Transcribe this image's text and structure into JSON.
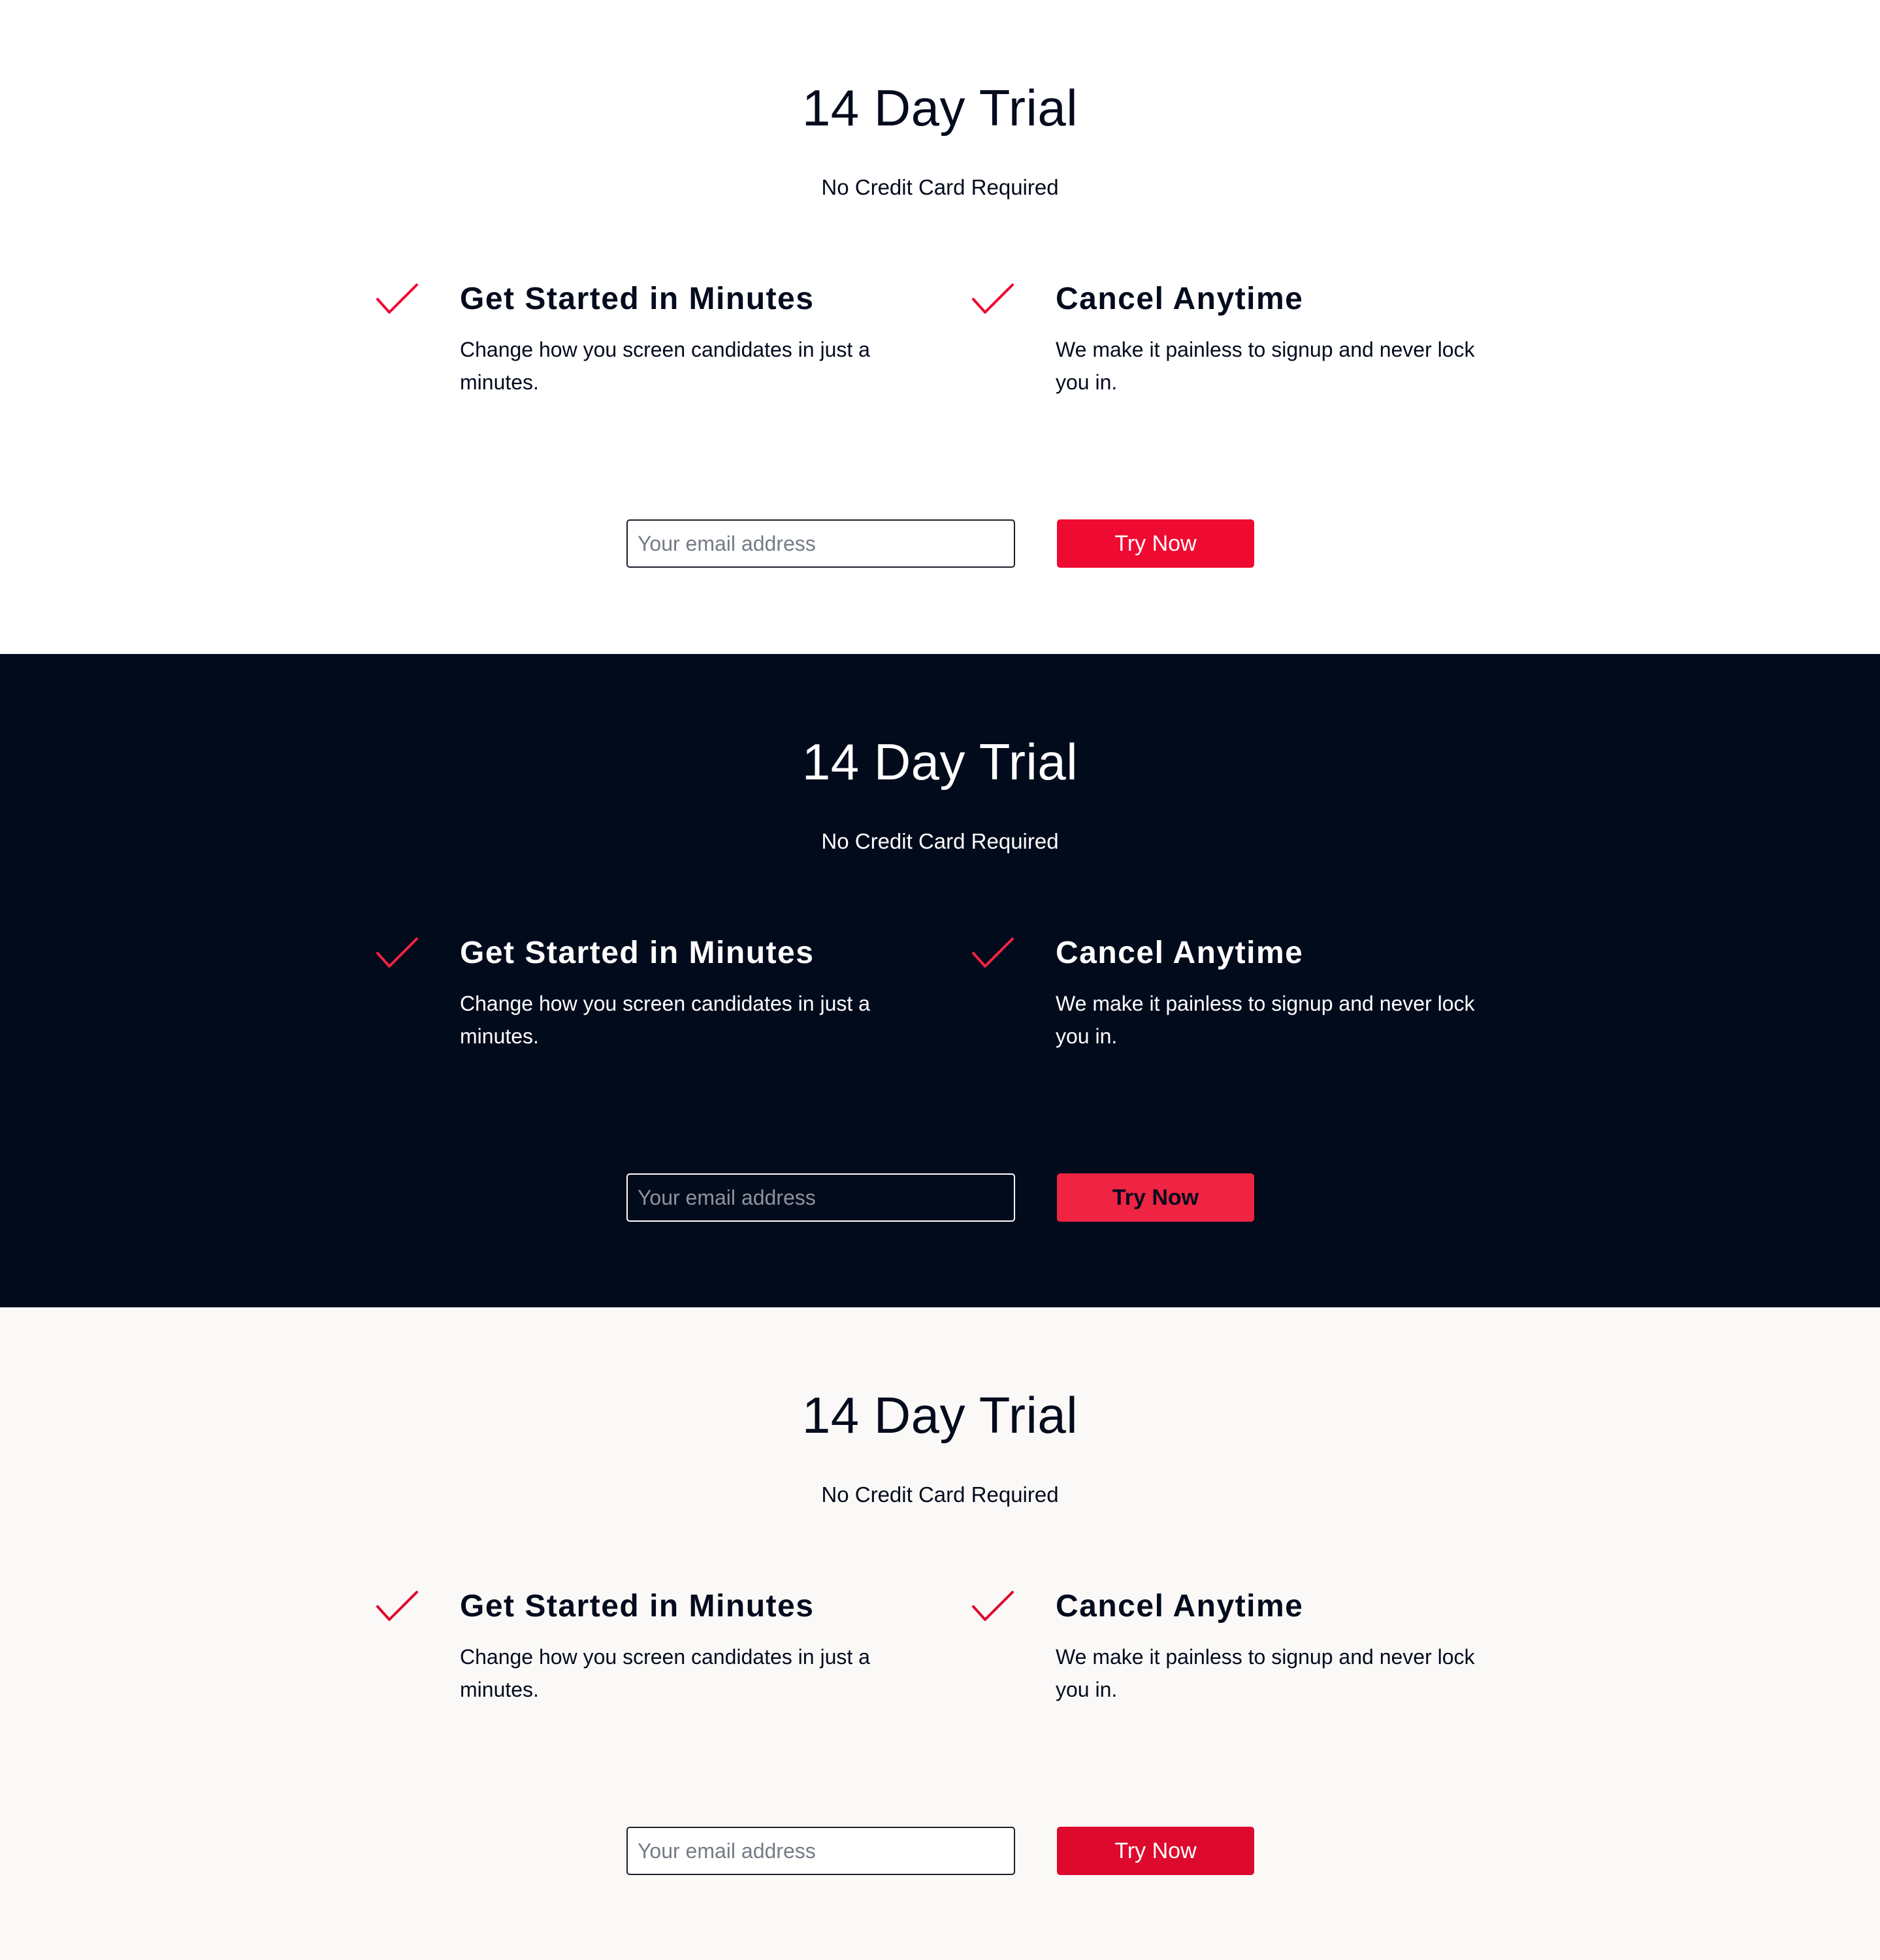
{
  "colors": {
    "accent_red": "#ef0a32",
    "dark_navy": "#020b1c",
    "light_bg": "#faf9f7",
    "white": "#ffffff"
  },
  "sections": [
    {
      "variant": "light",
      "title": "14 Day Trial",
      "subtitle": "No Credit Card Required",
      "features": [
        {
          "icon": "checkmark-icon",
          "title": "Get Started in Minutes",
          "description": "Change how you screen candidates in just a minutes."
        },
        {
          "icon": "checkmark-icon",
          "title": "Cancel Anytime",
          "description": "We make it painless to signup and never lock you in."
        }
      ],
      "email_placeholder": "Your email address",
      "button_label": "Try Now"
    },
    {
      "variant": "dark",
      "title": "14 Day Trial",
      "subtitle": "No Credit Card Required",
      "features": [
        {
          "icon": "checkmark-icon",
          "title": "Get Started in Minutes",
          "description": "Change how you screen candidates in just a minutes."
        },
        {
          "icon": "checkmark-icon",
          "title": "Cancel Anytime",
          "description": "We make it painless to signup and never lock you in."
        }
      ],
      "email_placeholder": "Your email address",
      "button_label": "Try Now"
    },
    {
      "variant": "off-white",
      "title": "14 Day Trial",
      "subtitle": "No Credit Card Required",
      "features": [
        {
          "icon": "checkmark-icon",
          "title": "Get Started in Minutes",
          "description": "Change how you screen candidates in just a minutes."
        },
        {
          "icon": "checkmark-icon",
          "title": "Cancel Anytime",
          "description": "We make it painless to signup and never lock you in."
        }
      ],
      "email_placeholder": "Your email address",
      "button_label": "Try Now"
    }
  ]
}
